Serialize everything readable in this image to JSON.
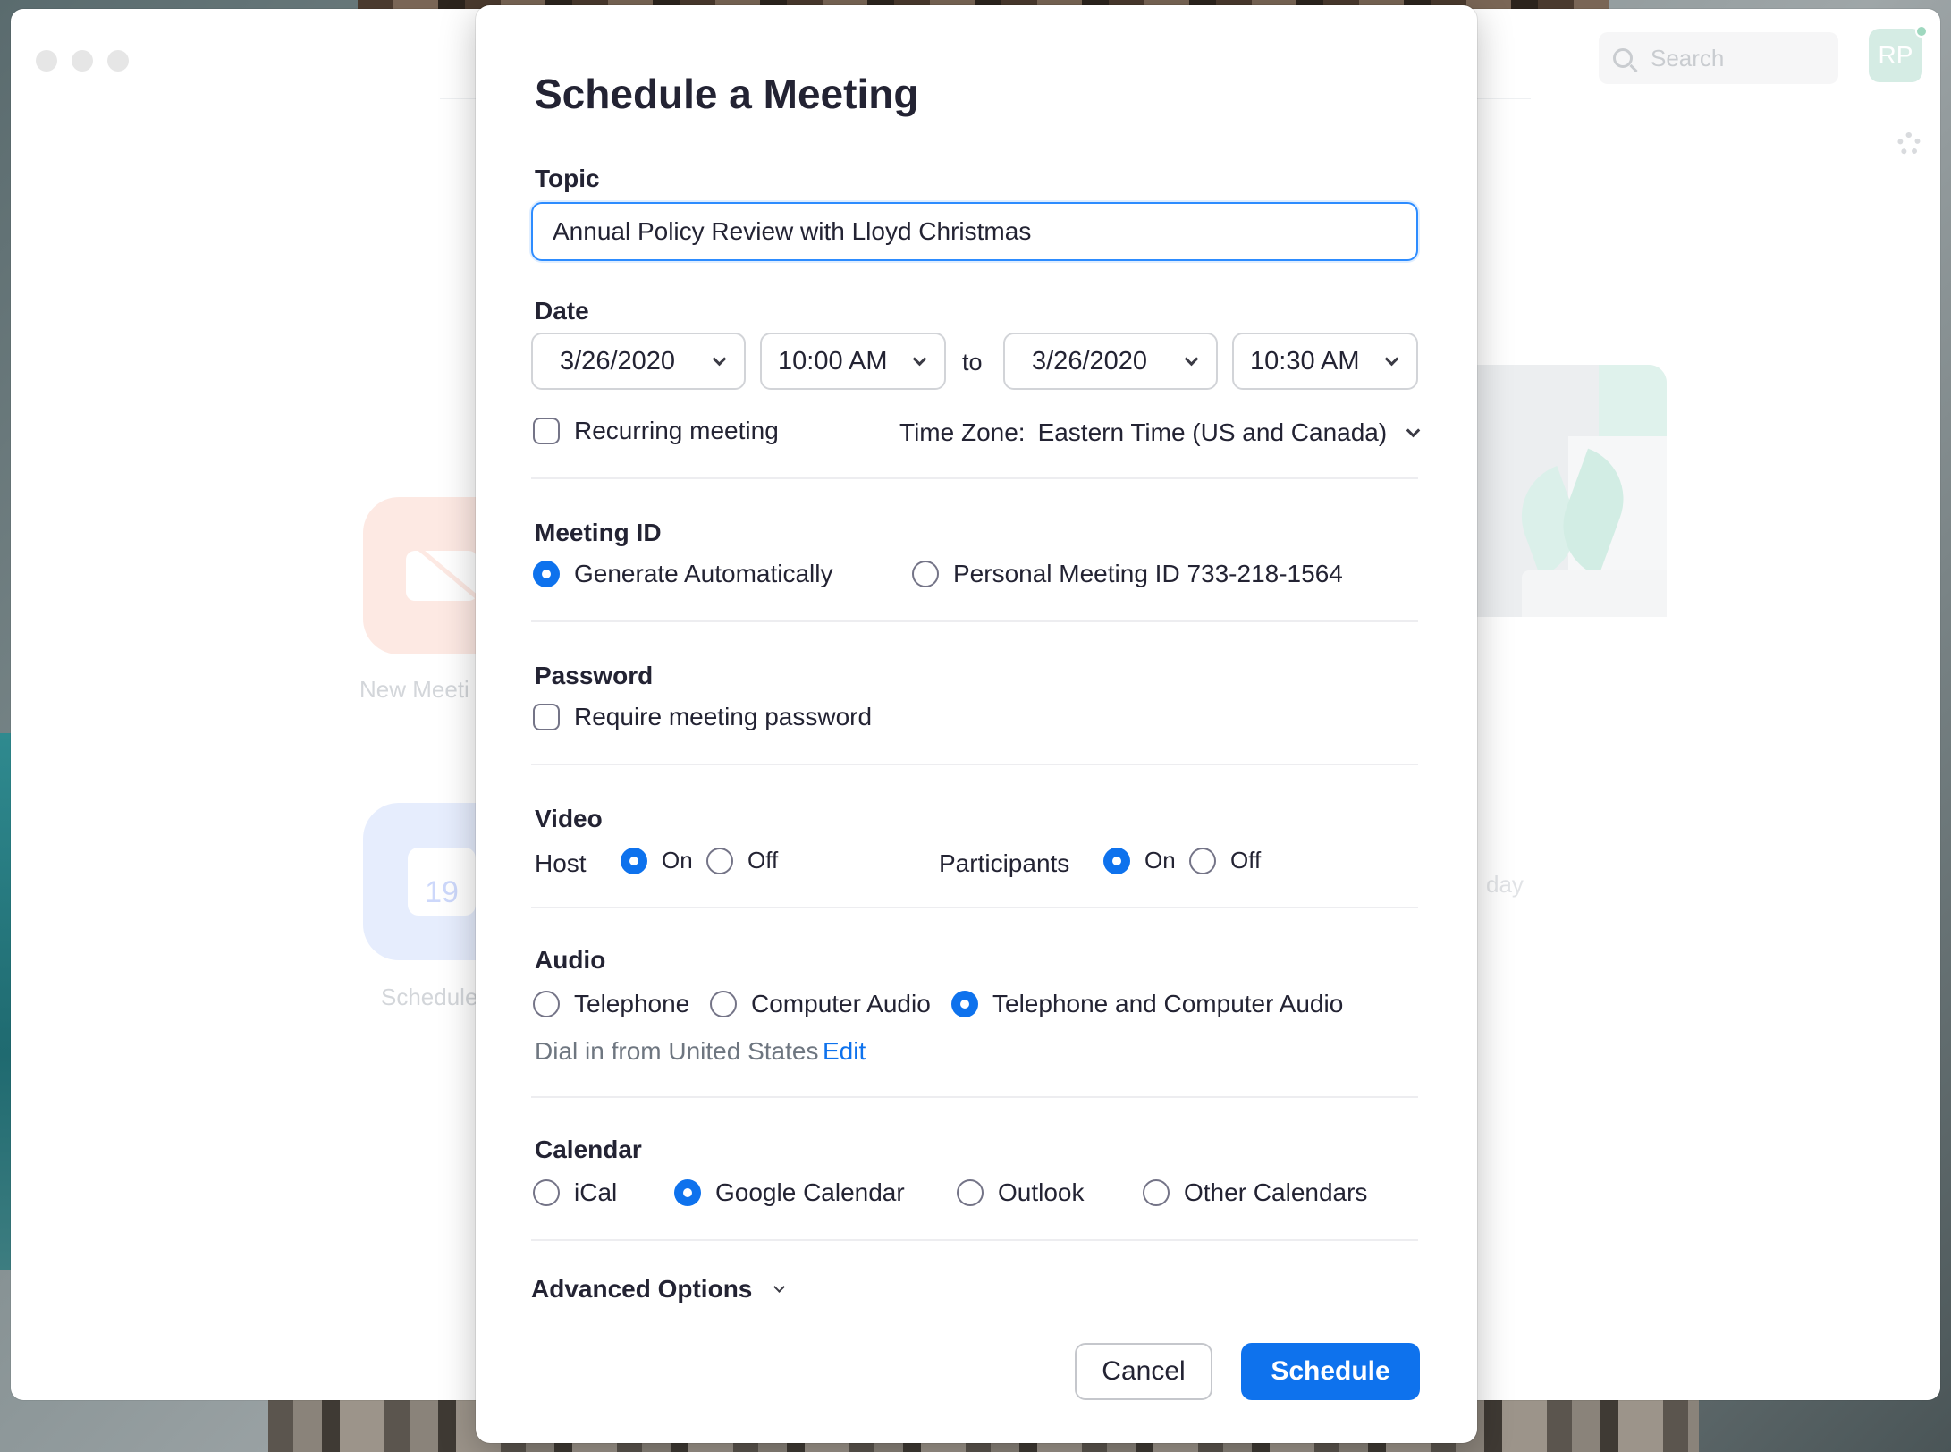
{
  "background_app": {
    "search_placeholder": "Search",
    "avatar_initials": "RP",
    "tile_new_meeting_label": "New Meeti",
    "tile_schedule_label": "Schedule",
    "tile_schedule_day": "19",
    "faded_text": "day"
  },
  "dialog": {
    "title": "Schedule a Meeting",
    "topic": {
      "label": "Topic",
      "value": "Annual Policy Review with Lloyd Christmas"
    },
    "date": {
      "label": "Date",
      "start_date": "3/26/2020",
      "start_time": "10:00 AM",
      "to_label": "to",
      "end_date": "3/26/2020",
      "end_time": "10:30 AM",
      "recurring_label": "Recurring meeting",
      "recurring_checked": false,
      "timezone_label": "Time Zone:",
      "timezone_value": "Eastern Time (US and Canada)"
    },
    "meeting_id": {
      "label": "Meeting ID",
      "options": [
        "Generate Automatically",
        "Personal Meeting ID 733-218-1564"
      ],
      "selected": "Generate Automatically"
    },
    "password": {
      "label": "Password",
      "require_label": "Require meeting password",
      "checked": false
    },
    "video": {
      "label": "Video",
      "host_label": "Host",
      "participants_label": "Participants",
      "on_label": "On",
      "off_label": "Off",
      "host_selected": "On",
      "participants_selected": "On"
    },
    "audio": {
      "label": "Audio",
      "options": [
        "Telephone",
        "Computer Audio",
        "Telephone and Computer Audio"
      ],
      "selected": "Telephone and Computer Audio",
      "dial_in_text": "Dial in from United States",
      "edit_link": "Edit"
    },
    "calendar": {
      "label": "Calendar",
      "options": [
        "iCal",
        "Google Calendar",
        "Outlook",
        "Other Calendars"
      ],
      "selected": "Google Calendar"
    },
    "advanced_options_label": "Advanced Options",
    "buttons": {
      "cancel": "Cancel",
      "schedule": "Schedule"
    }
  },
  "colors": {
    "accent": "#0e72ed",
    "focus_border": "#2d8cff",
    "text": "#232333"
  }
}
